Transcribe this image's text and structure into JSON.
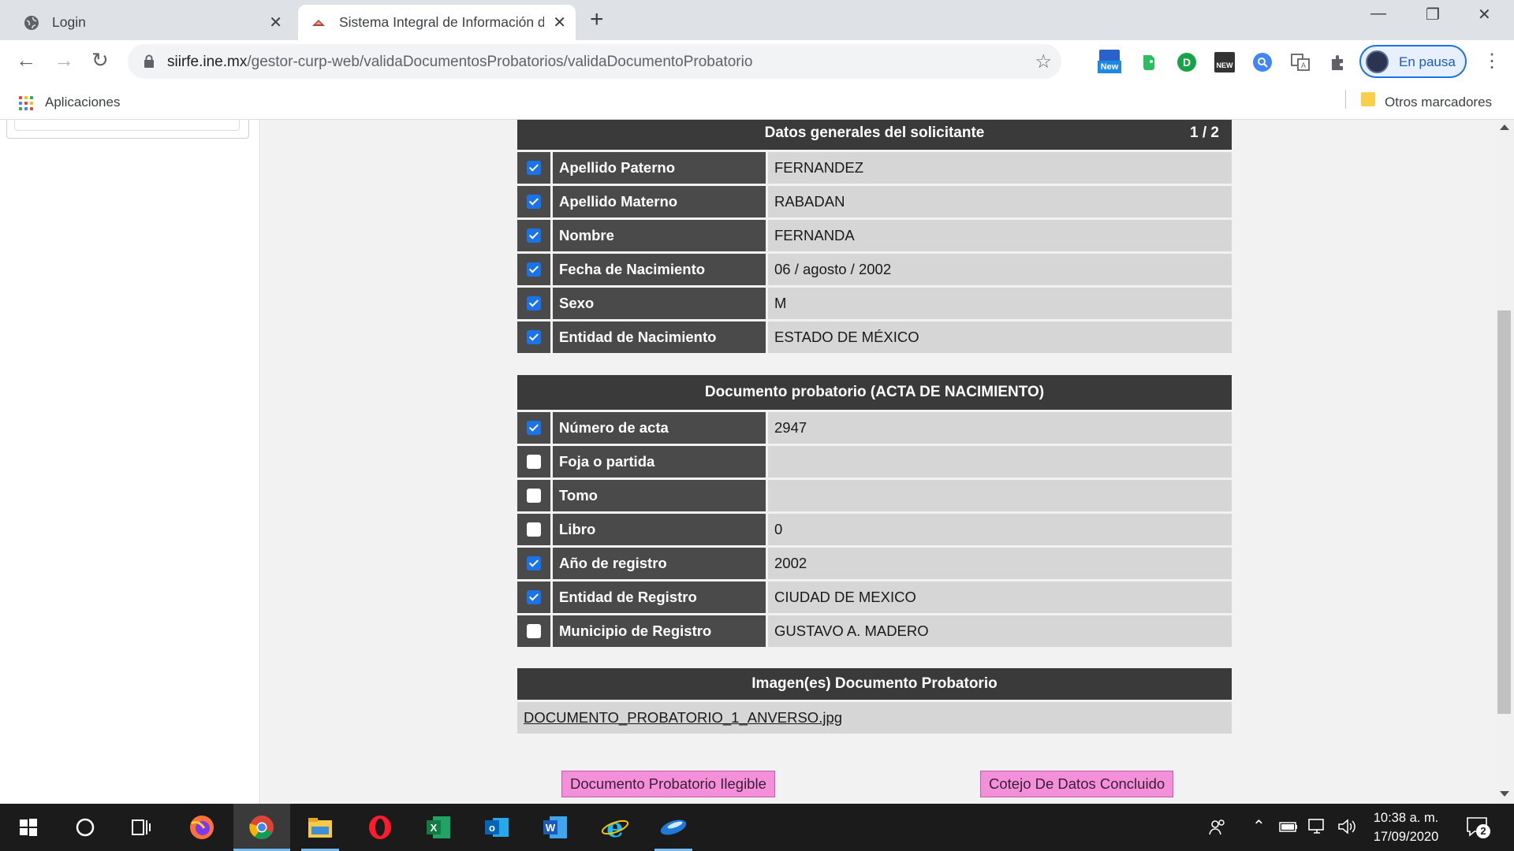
{
  "browser": {
    "tabs": [
      {
        "title": "Login",
        "active": false
      },
      {
        "title": "Sistema Integral de Información d",
        "active": true
      }
    ],
    "url_domain": "siirfe.ine.mx",
    "url_path": "/gestor-curp-web/validaDocumentosProbatorios/validaDocumentoProbatorio",
    "profile_label": "En pausa",
    "extension_badge": "New",
    "extension_badge2": "NEW",
    "bookmarks": {
      "apps": "Aplicaciones",
      "other": "Otros marcadores"
    }
  },
  "datos_generales": {
    "title": "Datos generales del solicitante",
    "page": "1 / 2",
    "rows": [
      {
        "label": "Apellido Paterno",
        "value": "FERNANDEZ",
        "checked": true
      },
      {
        "label": "Apellido Materno",
        "value": "RABADAN",
        "checked": true
      },
      {
        "label": "Nombre",
        "value": "FERNANDA",
        "checked": true
      },
      {
        "label": "Fecha de Nacimiento",
        "value": "06 / agosto / 2002",
        "checked": true
      },
      {
        "label": "Sexo",
        "value": "M",
        "checked": true
      },
      {
        "label": "Entidad de Nacimiento",
        "value": "ESTADO DE MÉXICO",
        "checked": true
      }
    ]
  },
  "documento": {
    "title": "Documento probatorio (ACTA DE NACIMIENTO)",
    "rows": [
      {
        "label": "Número de acta",
        "value": "2947",
        "checked": true
      },
      {
        "label": "Foja o partida",
        "value": "",
        "checked": false
      },
      {
        "label": "Tomo",
        "value": "",
        "checked": false
      },
      {
        "label": "Libro",
        "value": "0",
        "checked": false
      },
      {
        "label": "Año de registro",
        "value": "2002",
        "checked": true
      },
      {
        "label": "Entidad de Registro",
        "value": "CIUDAD DE MEXICO",
        "checked": true
      },
      {
        "label": "Municipio de Registro",
        "value": "GUSTAVO A. MADERO",
        "checked": false
      }
    ]
  },
  "imagenes": {
    "title": "Imagen(es) Documento Probatorio",
    "file": "DOCUMENTO_PROBATORIO_1_ANVERSO.jpg"
  },
  "actions": {
    "ilegible": "Documento Probatorio Ilegible",
    "concluido": "Cotejo De Datos Concluido"
  },
  "taskbar": {
    "time": "10:38 a. m.",
    "date": "17/09/2020",
    "notifications": "2"
  },
  "colors": {
    "header": "#3a3a3a",
    "label": "#4a4a4a",
    "value": "#d6d6d6",
    "button": "#f48fda",
    "check": "#1a73e8"
  }
}
